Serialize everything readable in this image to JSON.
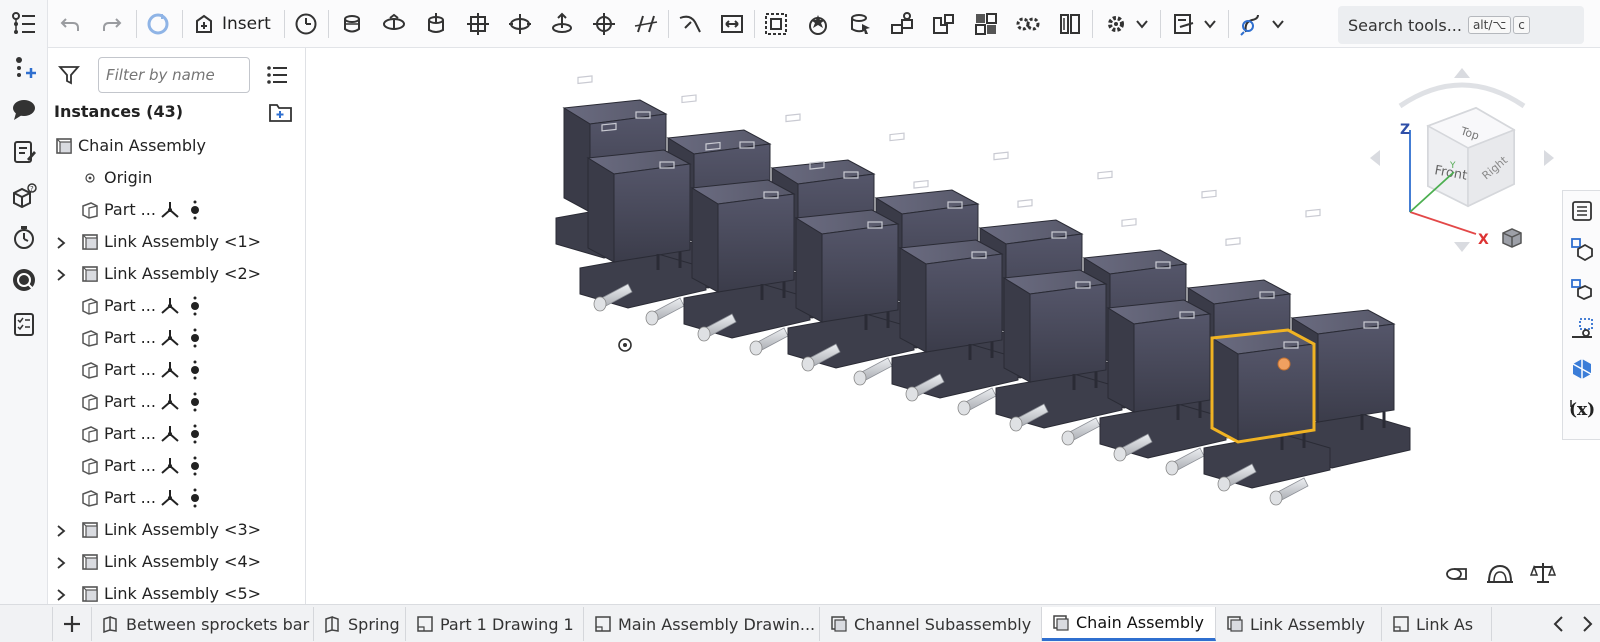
{
  "toolbar": {
    "insert_label": "Insert",
    "search_label": "Search tools...",
    "search_shortcut_1": "alt/⌥",
    "search_shortcut_2": "c"
  },
  "panel": {
    "filter_placeholder": "Filter by name",
    "instances_header": "Instances (43)",
    "items": [
      {
        "label": "Chain Assembly",
        "type": "assembly",
        "expandable": false,
        "indent": 0,
        "mates": false
      },
      {
        "label": "Origin",
        "type": "origin",
        "expandable": false,
        "indent": 1,
        "mates": false
      },
      {
        "label": "Part ...",
        "type": "part",
        "expandable": false,
        "indent": 1,
        "mates": true
      },
      {
        "label": "Link Assembly <1>",
        "type": "assembly",
        "expandable": true,
        "indent": 1,
        "mates": false
      },
      {
        "label": "Link Assembly <2>",
        "type": "assembly",
        "expandable": true,
        "indent": 1,
        "mates": false
      },
      {
        "label": "Part ...",
        "type": "part",
        "expandable": false,
        "indent": 1,
        "mates": true
      },
      {
        "label": "Part ...",
        "type": "part",
        "expandable": false,
        "indent": 1,
        "mates": true
      },
      {
        "label": "Part ...",
        "type": "part",
        "expandable": false,
        "indent": 1,
        "mates": true
      },
      {
        "label": "Part ...",
        "type": "part",
        "expandable": false,
        "indent": 1,
        "mates": true
      },
      {
        "label": "Part ...",
        "type": "part",
        "expandable": false,
        "indent": 1,
        "mates": true
      },
      {
        "label": "Part ...",
        "type": "part",
        "expandable": false,
        "indent": 1,
        "mates": true
      },
      {
        "label": "Part ...",
        "type": "part",
        "expandable": false,
        "indent": 1,
        "mates": true
      },
      {
        "label": "Link Assembly <3>",
        "type": "assembly",
        "expandable": true,
        "indent": 1,
        "mates": false
      },
      {
        "label": "Link Assembly <4>",
        "type": "assembly",
        "expandable": true,
        "indent": 1,
        "mates": false
      },
      {
        "label": "Link Assembly <5>",
        "type": "assembly",
        "expandable": true,
        "indent": 1,
        "mates": false
      }
    ]
  },
  "view_cube": {
    "top": "Top",
    "front": "Front",
    "right": "Right",
    "axis_z": "Z",
    "axis_x": "X",
    "axis_y": "Y"
  },
  "tabs": [
    {
      "label": "Between sprockets bar",
      "type": "part-studio",
      "active": false
    },
    {
      "label": "Spring",
      "type": "part-studio",
      "active": false
    },
    {
      "label": "Part 1 Drawing 1",
      "type": "drawing",
      "active": false
    },
    {
      "label": "Main Assembly Drawin...",
      "type": "drawing",
      "active": false
    },
    {
      "label": "Channel Subassembly",
      "type": "assembly",
      "active": false
    },
    {
      "label": "Chain Assembly",
      "type": "assembly",
      "active": true
    },
    {
      "label": "Link Assembly",
      "type": "assembly",
      "active": false
    },
    {
      "label": "Link As",
      "type": "drawing",
      "active": false
    }
  ],
  "colors": {
    "accent": "#2f6fcf",
    "selection": "#f0b323",
    "part_body": "#4a4b57",
    "pin": "#c9ccd1"
  }
}
